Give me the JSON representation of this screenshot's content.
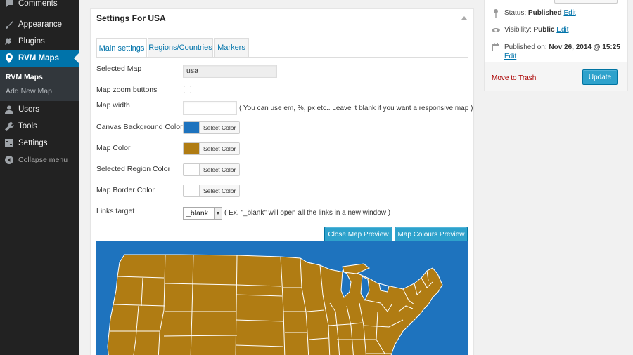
{
  "sidebar": {
    "items": [
      {
        "label": "Comments",
        "icon": "comment-icon"
      },
      {
        "label": "Appearance",
        "icon": "paintbrush-icon"
      },
      {
        "label": "Plugins",
        "icon": "plugin-icon"
      },
      {
        "label": "RVM Maps",
        "icon": "map-marker-icon"
      },
      {
        "label": "Users",
        "icon": "user-icon"
      },
      {
        "label": "Tools",
        "icon": "wrench-icon"
      },
      {
        "label": "Settings",
        "icon": "settings-icon"
      }
    ],
    "submenu": [
      {
        "label": "RVM Maps"
      },
      {
        "label": "Add New Map"
      }
    ],
    "collapse_label": "Collapse menu"
  },
  "postbox": {
    "title": "Settings For USA",
    "tabs": [
      {
        "label": "Main settings"
      },
      {
        "label": "Regions/Countries"
      },
      {
        "label": "Markers"
      }
    ],
    "fields": {
      "selected_map": {
        "label": "Selected Map",
        "value": "usa"
      },
      "zoom_buttons": {
        "label": "Map zoom buttons"
      },
      "map_width": {
        "label": "Map width",
        "value": "",
        "hint": "( You can use em, %, px etc.. Leave it blank if you want a responsive map )"
      },
      "canvas_bg": {
        "label": "Canvas Background Color",
        "color": "#1e73be",
        "button": "Select Color"
      },
      "map_color": {
        "label": "Map Color",
        "color": "#b07c13",
        "button": "Select Color"
      },
      "selected_region": {
        "label": "Selected Region Color",
        "color": "#ffffff",
        "button": "Select Color"
      },
      "border_color": {
        "label": "Map Border Color",
        "color": "#ffffff",
        "button": "Select Color"
      },
      "links_target": {
        "label": "Links target",
        "value": "_blank",
        "hint": "( Ex. \"_blank\" will open all the links in a new window )"
      }
    },
    "buttons": {
      "close_preview": "Close Map Preview",
      "colours_preview": "Map Colours Preview"
    }
  },
  "publish": {
    "status_label": "Status:",
    "status_value": "Published",
    "visibility_label": "Visibility:",
    "visibility_value": "Public",
    "published_label": "Published on:",
    "published_value": "Nov 26, 2014 @ 15:25",
    "edit": "Edit",
    "trash": "Move to Trash",
    "update": "Update"
  },
  "colors": {
    "admin_bar": "#222222",
    "accent": "#0073aa",
    "button_primary": "#2ea2cc",
    "map_fill": "#b07c13",
    "map_canvas": "#1e73be"
  }
}
